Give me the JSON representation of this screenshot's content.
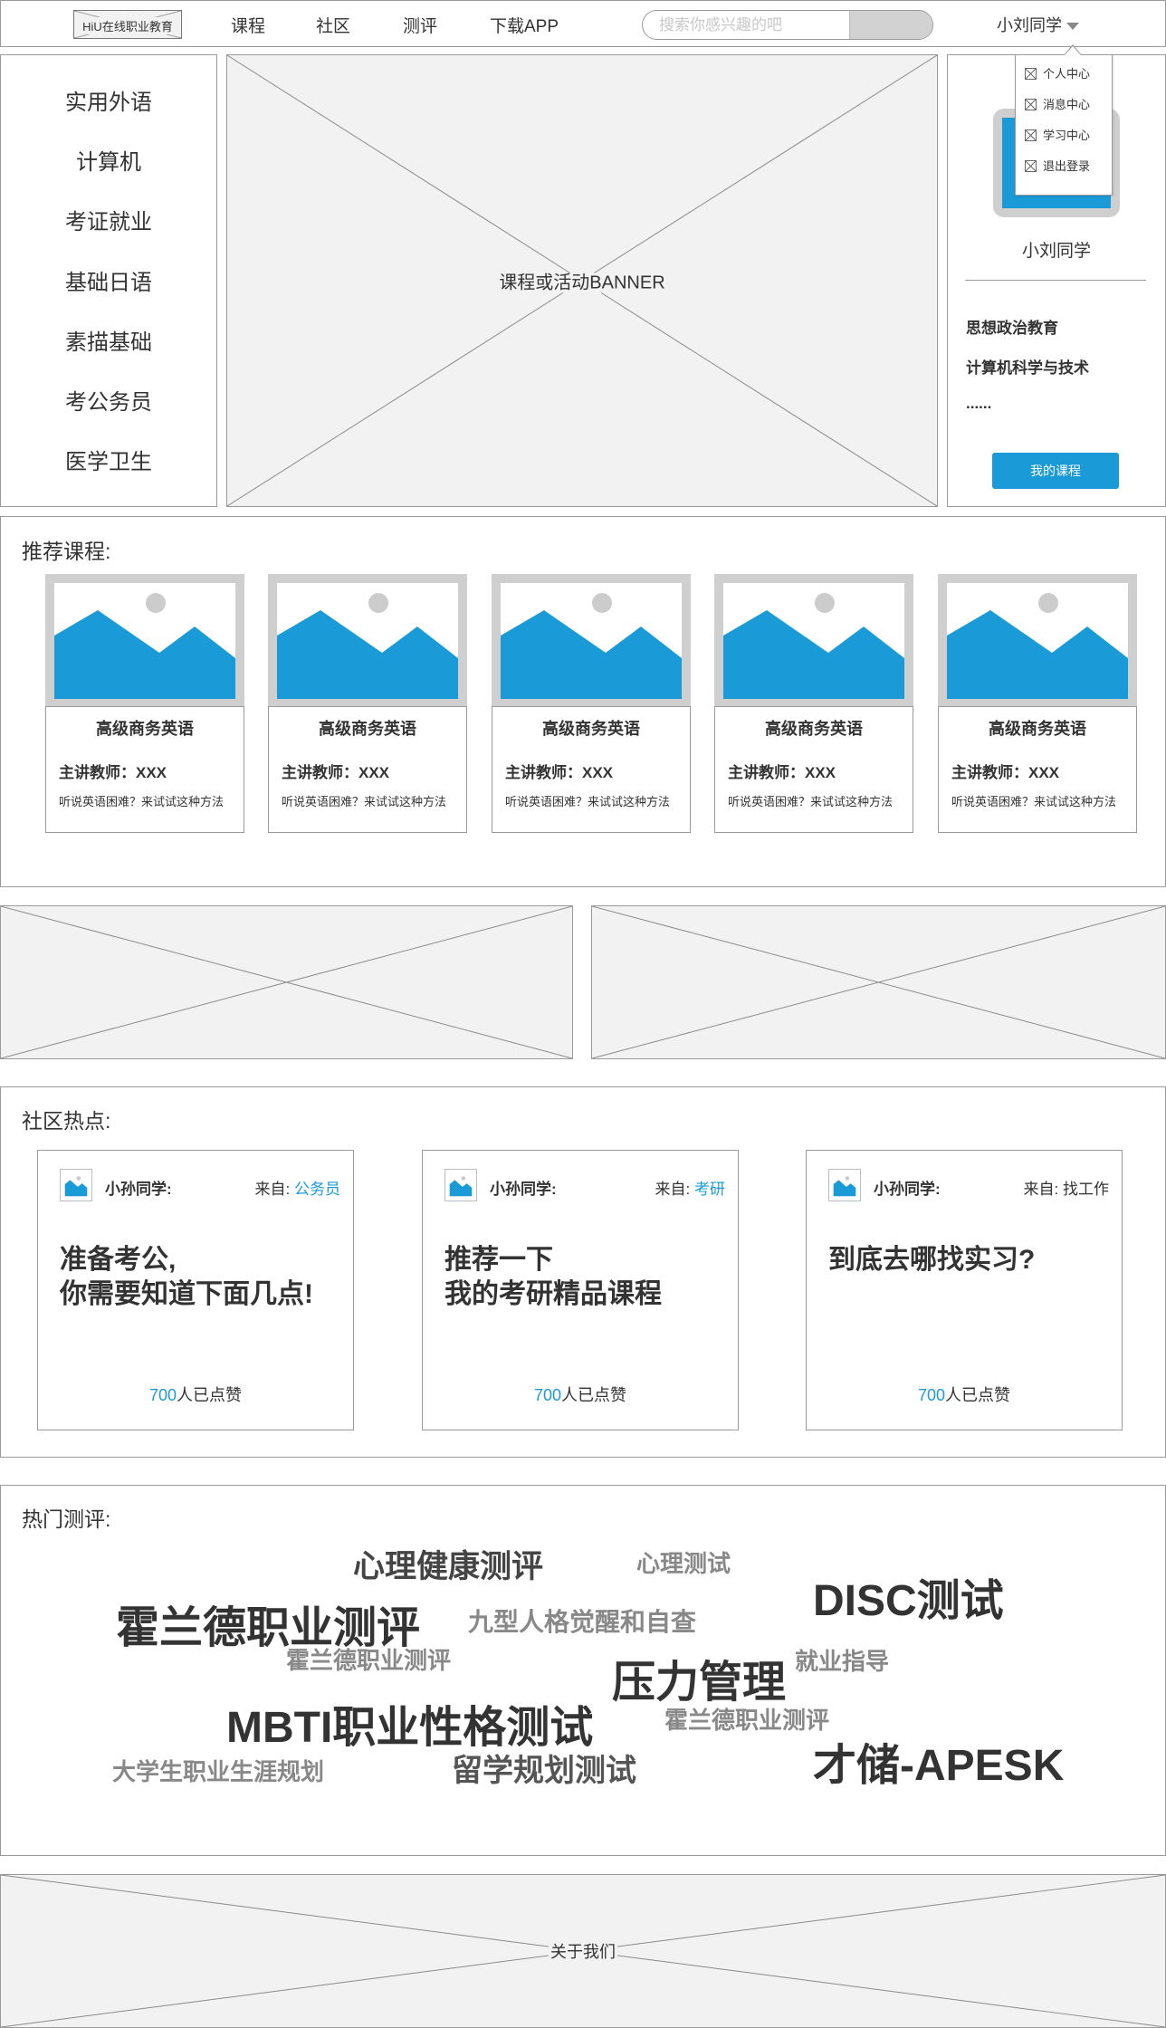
{
  "header": {
    "logo_text": "HiU在线职业教育",
    "nav": [
      "课程",
      "社区",
      "测评",
      "下载APP"
    ],
    "search_placeholder": "搜索你感兴趣的吧",
    "user_name": "小刘同学"
  },
  "dropdown": {
    "items": [
      "个人中心",
      "消息中心",
      "学习中心",
      "退出登录"
    ]
  },
  "categories": [
    "实用外语",
    "计算机",
    "考证就业",
    "基础日语",
    "素描基础",
    "考公务员",
    "医学卫生"
  ],
  "banner": {
    "caption": "课程或活动BANNER"
  },
  "profile": {
    "name": "小刘同学",
    "courses": [
      "思想政治教育",
      "计算机科学与技术",
      "......"
    ],
    "my_course_button": "我的课程"
  },
  "recommend": {
    "title": "推荐课程:",
    "courses": [
      {
        "title": "高级商务英语",
        "teacher": "主讲教师：XXX",
        "desc": "听说英语困难？来试试这种方法"
      },
      {
        "title": "高级商务英语",
        "teacher": "主讲教师：XXX",
        "desc": "听说英语困难？来试试这种方法"
      },
      {
        "title": "高级商务英语",
        "teacher": "主讲教师：XXX",
        "desc": "听说英语困难？来试试这种方法"
      },
      {
        "title": "高级商务英语",
        "teacher": "主讲教师：XXX",
        "desc": "听说英语困难？来试试这种方法"
      },
      {
        "title": "高级商务英语",
        "teacher": "主讲教师：XXX",
        "desc": "听说英语困难？来试试这种方法"
      }
    ]
  },
  "community": {
    "title": "社区热点:",
    "posts": [
      {
        "author": "小孙同学:",
        "from_label": "来自:",
        "from_tag": "公务员",
        "title_line1": "准备考公,",
        "title_line2": "你需要知道下面几点!",
        "likes_num": "700",
        "likes_text": "人已点赞"
      },
      {
        "author": "小孙同学:",
        "from_label": "来自:",
        "from_tag": "考研",
        "title_line1": "推荐一下",
        "title_line2": "我的考研精品课程",
        "likes_num": "700",
        "likes_text": "人已点赞"
      },
      {
        "author": "小孙同学:",
        "from_label": "来自:",
        "from_tag": "找工作",
        "title_line1": "到底去哪找实习?",
        "title_line2": "",
        "likes_num": "700",
        "likes_text": "人已点赞"
      }
    ]
  },
  "assessment": {
    "title": "热门测评:",
    "tags": [
      "心理健康测评",
      "心理测试",
      "DISC测试",
      "霍兰德职业测评",
      "九型人格觉醒和自查",
      "霍兰德职业测评",
      "压力管理",
      "就业指导",
      "MBTI职业性格测试",
      "霍兰德职业测评",
      "才储-APESK",
      "大学生职业生涯规划",
      "留学规划测试"
    ]
  },
  "footer": {
    "caption": "关于我们"
  },
  "colors": {
    "accent": "#1a9bd7",
    "placeholder_bg": "#f2f2f2",
    "border": "#9a9a9a",
    "image_frame": "#cfcfcf"
  },
  "icons": {
    "image_placeholder": "image-icon",
    "dropdown_item": "x-box-icon",
    "user_caret": "chevron-down-icon"
  }
}
